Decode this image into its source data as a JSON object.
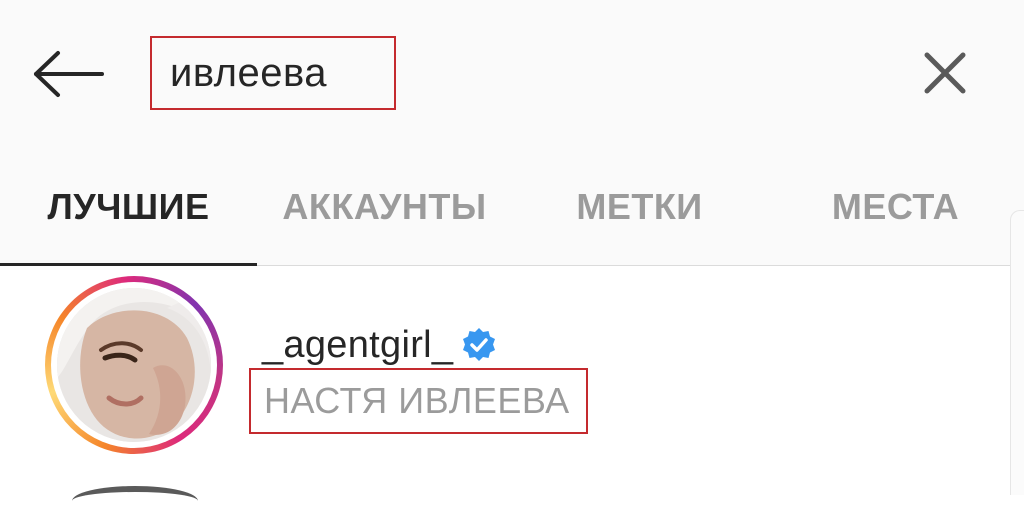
{
  "search": {
    "query": "ивлеева"
  },
  "icons": {
    "back": "arrow-left-icon",
    "clear": "close-icon",
    "verified": "verified-badge-icon"
  },
  "tabs": [
    {
      "label": "ЛУЧШИЕ",
      "active": true
    },
    {
      "label": "АККАУНТЫ",
      "active": false
    },
    {
      "label": "МЕТКИ",
      "active": false
    },
    {
      "label": "МЕСТА",
      "active": false
    }
  ],
  "results": [
    {
      "username": "_agentgirl_",
      "verified": true,
      "full_name": "НАСТЯ ИВЛЕЕВА"
    }
  ],
  "colors": {
    "highlight_border": "#c42a2e",
    "verified_blue": "#3897f0",
    "text_primary": "#262626",
    "text_secondary": "#9b9b9b"
  }
}
